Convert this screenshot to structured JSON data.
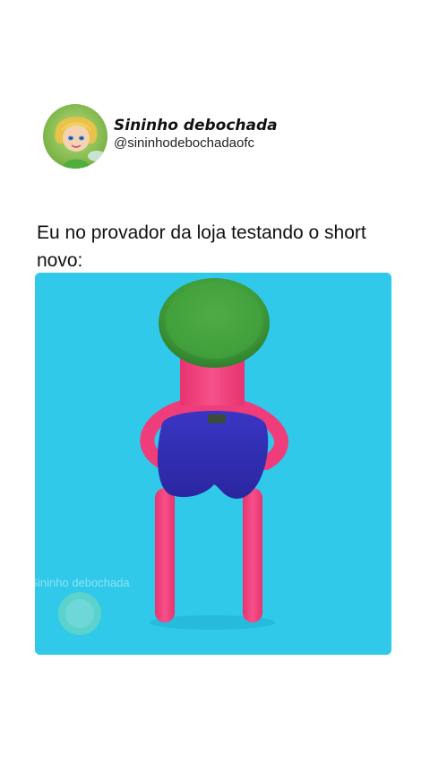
{
  "post": {
    "display_name": "Sininho debochada",
    "handle": "@sininhodebochadaofc",
    "avatar_icon": "fairy-avatar-icon",
    "caption": "Eu no provador da loja testando o short novo:"
  },
  "media": {
    "watermark_text": "Sininho debochada",
    "background_color": "#30c9ea",
    "figure_color": "#ef3d7c",
    "hair_color": "#3f9c3a",
    "shorts_color": "#3532b8"
  }
}
